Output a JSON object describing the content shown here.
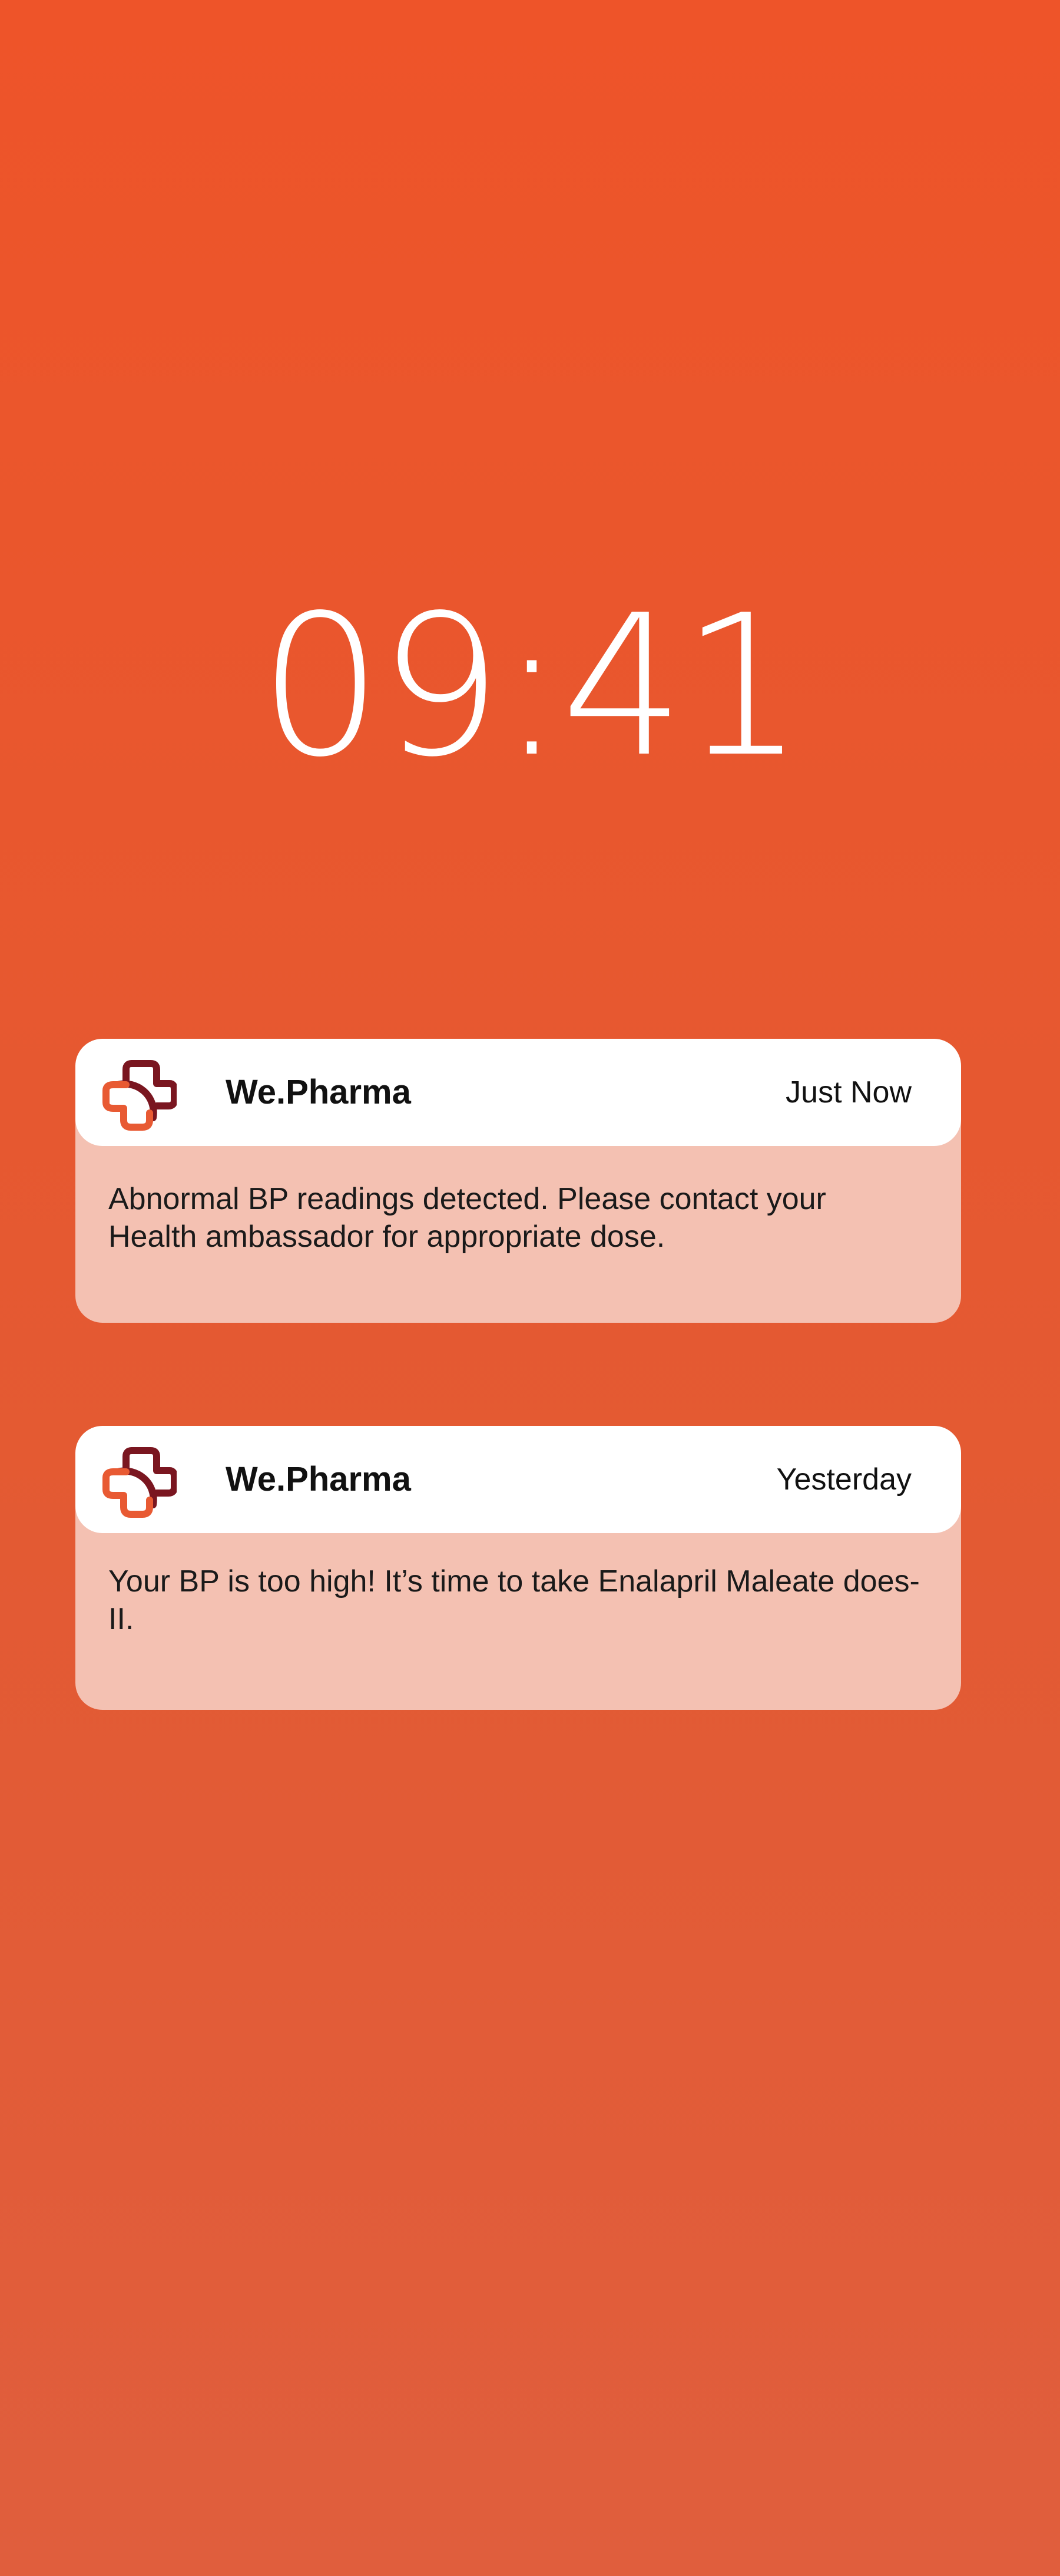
{
  "lock_screen": {
    "time": "09:41"
  },
  "notifications": [
    {
      "app_name": "We.Pharma",
      "time": "Just Now",
      "message": "Abnormal BP readings detected. Please contact your Health ambassador for appropriate dose.",
      "icon": "we-pharma-cross-logo"
    },
    {
      "app_name": "We.Pharma",
      "time": "Yesterday",
      "message": "Your BP is too high! It’s time to take Enalapril Maleate does-II.",
      "icon": "we-pharma-cross-logo"
    }
  ],
  "colors": {
    "background_top": "#EE5429",
    "background_bottom": "#E05E3D",
    "notification_body": "#F4C1B2",
    "notification_header": "#FFFFFF",
    "logo_dark": "#7A1620",
    "logo_accent": "#E85A33"
  }
}
